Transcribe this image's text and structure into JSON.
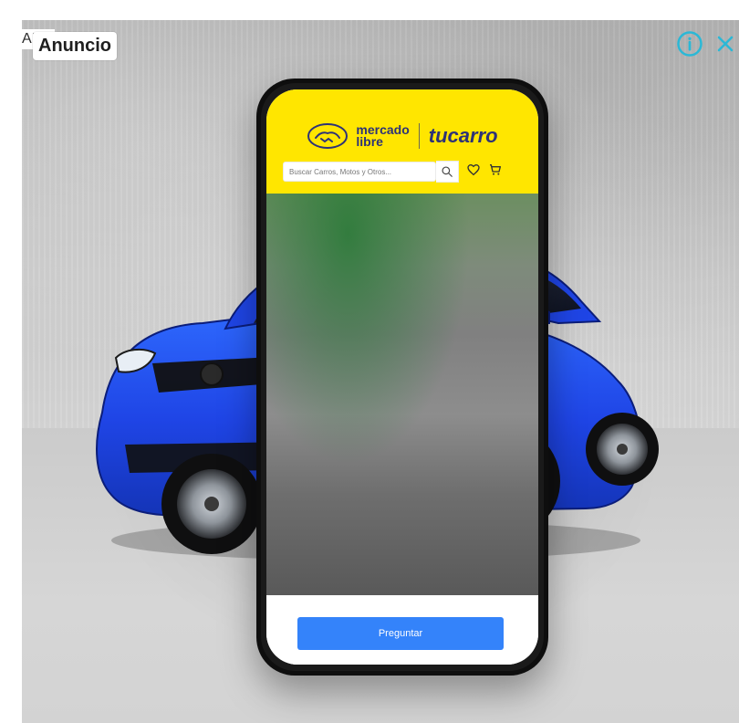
{
  "ad": {
    "label": "AD",
    "tag": "Anuncio",
    "info_icon": "info-icon",
    "close_icon": "close-icon",
    "accent_color": "#2BB8D6"
  },
  "phone": {
    "brand": {
      "mercado_line1": "mercado",
      "mercado_line2": "libre",
      "tu": "tu",
      "carro": "carro"
    },
    "search_placeholder": "Buscar Carros, Motos y Otros...",
    "button_label": "Preguntar",
    "colors": {
      "header": "#FFE600",
      "brand_text": "#2D3277",
      "cta": "#3483FA"
    }
  }
}
